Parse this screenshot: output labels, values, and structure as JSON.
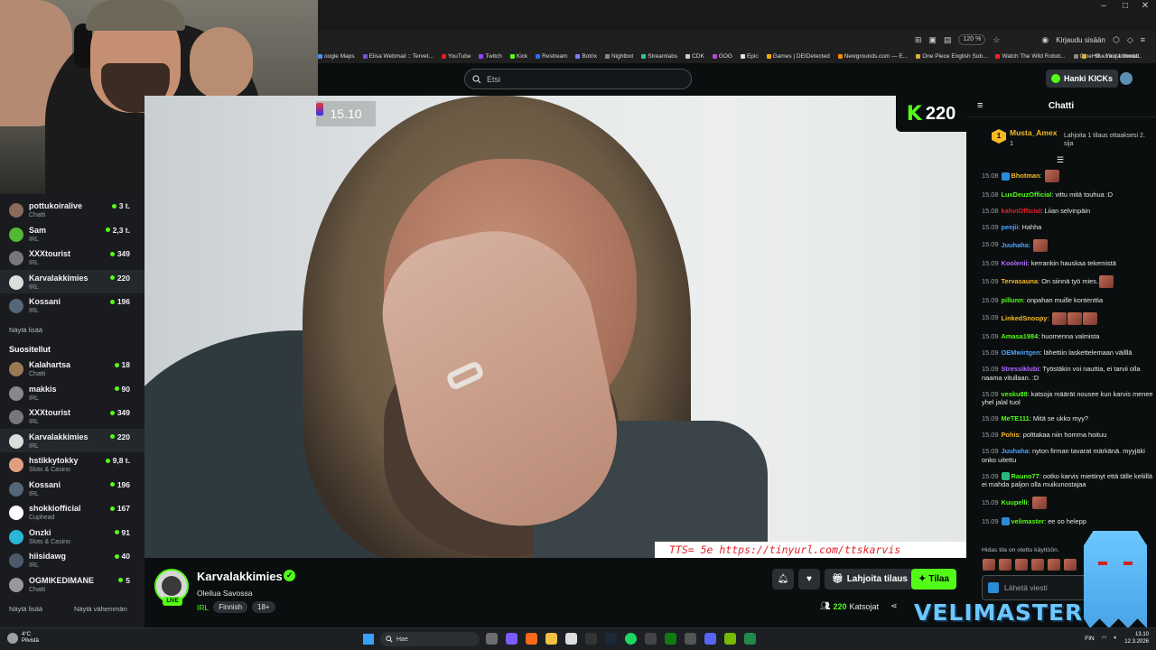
{
  "browser": {
    "zoom": "120 %",
    "signin": "Kirjaudu sisään",
    "bookmarks": [
      {
        "label": "oogle Maps",
        "color": "#4c8bf5"
      },
      {
        "label": "Elisa Webmail :: Tervet...",
        "color": "#7a4fd4"
      },
      {
        "label": "YouTube",
        "color": "#e62117"
      },
      {
        "label": "Twitch",
        "color": "#9146ff"
      },
      {
        "label": "Kick",
        "color": "#53fc18"
      },
      {
        "label": "Restream",
        "color": "#2f6bff"
      },
      {
        "label": "Botrix",
        "color": "#7b7bff"
      },
      {
        "label": "Nightbot",
        "color": "#888888"
      },
      {
        "label": "Streamlabs",
        "color": "#31c3a2"
      },
      {
        "label": "CDK",
        "color": "#cccccc"
      },
      {
        "label": "GOG",
        "color": "#b44ad1"
      },
      {
        "label": "Epic",
        "color": "#dddddd"
      },
      {
        "label": "Games | DEIDetected",
        "color": "#ffaa00"
      },
      {
        "label": "Newgrounds.com — E...",
        "color": "#f28b00"
      },
      {
        "label": "One Piece English Sub...",
        "color": "#d9b23a"
      },
      {
        "label": "Watch The Wild Robot...",
        "color": "#e22"
      },
      {
        "label": "CineHD - Your Ultimat...",
        "color": "#888"
      }
    ],
    "bookmarks_more": "Muut kirjanmerkit"
  },
  "header": {
    "search_placeholder": "Etsi",
    "get_kicks": "Hanki KICKs"
  },
  "sidebar": {
    "following": [
      {
        "name": "pottukoiralive",
        "cat": "Chatti",
        "count": "3 t.",
        "color": "#8a6a5a"
      },
      {
        "name": "Sam",
        "cat": "IRL",
        "count": "2,3 t.",
        "color": "#53b833"
      },
      {
        "name": "XXXtourist",
        "cat": "IRL",
        "count": "349",
        "color": "#777777"
      },
      {
        "name": "Karvalakkimies",
        "cat": "IRL",
        "count": "220",
        "color": "#dddddd"
      },
      {
        "name": "Kossani",
        "cat": "IRL",
        "count": "196",
        "color": "#556677"
      }
    ],
    "show_more": "Näytä lisää",
    "section_title": "Suositellut",
    "recommended": [
      {
        "name": "Kalahartsa",
        "cat": "Chatti",
        "count": "18",
        "color": "#9a7a55"
      },
      {
        "name": "makkis",
        "cat": "IRL",
        "count": "90",
        "color": "#888888"
      },
      {
        "name": "XXXtourist",
        "cat": "IRL",
        "count": "349",
        "color": "#777777"
      },
      {
        "name": "Karvalakkimies",
        "cat": "IRL",
        "count": "220",
        "color": "#dddddd"
      },
      {
        "name": "hstikkytokky",
        "cat": "Slots & Casino",
        "count": "9,8 t.",
        "color": "#e0a080"
      },
      {
        "name": "Kossani",
        "cat": "IRL",
        "count": "196",
        "color": "#556677"
      },
      {
        "name": "shokkiofficial",
        "cat": "Cuphead",
        "count": "167",
        "color": "#ffffff"
      },
      {
        "name": "Onzki",
        "cat": "Slots & Casino",
        "count": "91",
        "color": "#29b6d8"
      },
      {
        "name": "hiisidawg",
        "cat": "IRL",
        "count": "40",
        "color": "#4a5a6a"
      },
      {
        "name": "OGMIKEDIMANE",
        "cat": "Chatti",
        "count": "5",
        "color": "#999999"
      }
    ],
    "show_more_2": "Näytä lisää",
    "show_less": "Näytä vähemmän"
  },
  "video": {
    "time_overlay": "15.10",
    "kick_count": "220",
    "tts": "TTS= 5e https://tinyurl.com/ttskarvis"
  },
  "stream": {
    "channel": "Karvalakkimies",
    "live": "LIVE",
    "title": "Oleilua Savossa",
    "category": "IRL",
    "tags": [
      "Finnish",
      "18+"
    ],
    "gift_label": "Lahjoita tilaus",
    "sub_label": "Tilaa",
    "viewers_count": "220",
    "viewers_label": "Katsojat"
  },
  "chat": {
    "title": "Chatti",
    "pinned_user": "Musta_Amex",
    "pinned_sub": "1",
    "pinned_gift": "Lahjoita 1 tilaus ottaaksesi 2. sija",
    "messages": [
      {
        "t": "15.08",
        "u": "Bhotman",
        "c": "#f5b925",
        "m": "",
        "emotes": 1,
        "badge": "#2a8cd6"
      },
      {
        "t": "15.08",
        "u": "LuxDeuzOfficial",
        "c": "#53fc18",
        "m": "vittu mitä touhua :D",
        "emotes": 0
      },
      {
        "t": "15.08",
        "u": "kahviOfficial",
        "c": "#e0242b",
        "m": "Liian selvinpäin",
        "emotes": 0
      },
      {
        "t": "15.09",
        "u": "peejii",
        "c": "#4aa3ff",
        "m": "Hahha",
        "emotes": 0
      },
      {
        "t": "15.09",
        "u": "Juuhaha",
        "c": "#4aa3ff",
        "m": "",
        "emotes": 1
      },
      {
        "t": "15.09",
        "u": "Koolenii",
        "c": "#b06cff",
        "m": "kerrankin hauskaa tekemistä",
        "emotes": 0
      },
      {
        "t": "15.09",
        "u": "Tervasauna",
        "c": "#f5b925",
        "m": "On siinnä työ mies.",
        "emotes": 1
      },
      {
        "t": "15.09",
        "u": "pillunn",
        "c": "#53fc18",
        "m": "onpahan muille kontenttia",
        "emotes": 0
      },
      {
        "t": "15.09",
        "u": "LinkedSnoopy",
        "c": "#f5b925",
        "m": "",
        "emotes": 3
      },
      {
        "t": "15.09",
        "u": "Amasa1984",
        "c": "#53fc18",
        "m": "huomenna valmista",
        "emotes": 0
      },
      {
        "t": "15.09",
        "u": "OEMwirtgen",
        "c": "#4aa3ff",
        "m": "lähettiin laskettelemaan väilllä",
        "emotes": 0
      },
      {
        "t": "15.09",
        "u": "Stressiklubi",
        "c": "#b06cff",
        "m": "Työstäkin voi nauttia, ei tarvii olla naama vitullaan. :D",
        "emotes": 0
      },
      {
        "t": "15.09",
        "u": "vesku88",
        "c": "#53fc18",
        "m": "katsoja määrät nousee kun karvis menee yhel jalal tuol",
        "emotes": 0
      },
      {
        "t": "15.09",
        "u": "MeTE111",
        "c": "#53fc18",
        "m": "Mitä se ukko myy?",
        "emotes": 0
      },
      {
        "t": "15.09",
        "u": "Pohis",
        "c": "#f5b925",
        "m": "polttakaa niin homma hoituu",
        "emotes": 0
      },
      {
        "t": "15.09",
        "u": "Juuhaha",
        "c": "#4aa3ff",
        "m": "nyton firman tavarat märkänä. myyjäki onko uitettu",
        "emotes": 0
      },
      {
        "t": "15.09",
        "u": "Rauno77",
        "c": "#53fc18",
        "m": "ootko karvis miettinyt että tälle keliillä ei mahda paljon olla muikunostajaa",
        "emotes": 0,
        "badge": "#2cb67d"
      },
      {
        "t": "15.09",
        "u": "Kuupelli",
        "c": "#53fc18",
        "m": "",
        "emotes": 1
      },
      {
        "t": "15.09",
        "u": "velimaster",
        "c": "#53fc18",
        "m": "ee oo helepp",
        "emotes": 0,
        "badge": "#2a8cd6"
      }
    ],
    "slow_note": "Hidas tila on otettu käyttöön.",
    "input_placeholder": "Lähetä viesti",
    "overlay_text": "VELIMASTER"
  },
  "taskbar": {
    "weather_temp": "4°C",
    "weather_desc": "Pilvistä",
    "search_placeholder": "Hae",
    "lang": "FIN",
    "time": "13.10",
    "date": "12.3.2026"
  }
}
